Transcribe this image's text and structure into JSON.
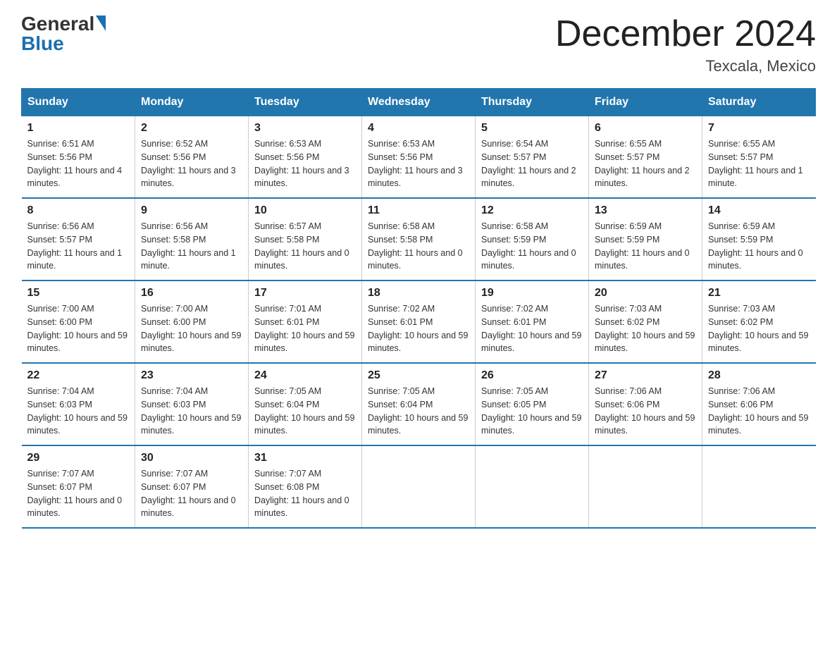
{
  "logo": {
    "general": "General",
    "blue": "Blue"
  },
  "title": "December 2024",
  "location": "Texcala, Mexico",
  "days_of_week": [
    "Sunday",
    "Monday",
    "Tuesday",
    "Wednesday",
    "Thursday",
    "Friday",
    "Saturday"
  ],
  "weeks": [
    [
      {
        "day": "1",
        "sunrise": "6:51 AM",
        "sunset": "5:56 PM",
        "daylight": "11 hours and 4 minutes."
      },
      {
        "day": "2",
        "sunrise": "6:52 AM",
        "sunset": "5:56 PM",
        "daylight": "11 hours and 3 minutes."
      },
      {
        "day": "3",
        "sunrise": "6:53 AM",
        "sunset": "5:56 PM",
        "daylight": "11 hours and 3 minutes."
      },
      {
        "day": "4",
        "sunrise": "6:53 AM",
        "sunset": "5:56 PM",
        "daylight": "11 hours and 3 minutes."
      },
      {
        "day": "5",
        "sunrise": "6:54 AM",
        "sunset": "5:57 PM",
        "daylight": "11 hours and 2 minutes."
      },
      {
        "day": "6",
        "sunrise": "6:55 AM",
        "sunset": "5:57 PM",
        "daylight": "11 hours and 2 minutes."
      },
      {
        "day": "7",
        "sunrise": "6:55 AM",
        "sunset": "5:57 PM",
        "daylight": "11 hours and 1 minute."
      }
    ],
    [
      {
        "day": "8",
        "sunrise": "6:56 AM",
        "sunset": "5:57 PM",
        "daylight": "11 hours and 1 minute."
      },
      {
        "day": "9",
        "sunrise": "6:56 AM",
        "sunset": "5:58 PM",
        "daylight": "11 hours and 1 minute."
      },
      {
        "day": "10",
        "sunrise": "6:57 AM",
        "sunset": "5:58 PM",
        "daylight": "11 hours and 0 minutes."
      },
      {
        "day": "11",
        "sunrise": "6:58 AM",
        "sunset": "5:58 PM",
        "daylight": "11 hours and 0 minutes."
      },
      {
        "day": "12",
        "sunrise": "6:58 AM",
        "sunset": "5:59 PM",
        "daylight": "11 hours and 0 minutes."
      },
      {
        "day": "13",
        "sunrise": "6:59 AM",
        "sunset": "5:59 PM",
        "daylight": "11 hours and 0 minutes."
      },
      {
        "day": "14",
        "sunrise": "6:59 AM",
        "sunset": "5:59 PM",
        "daylight": "11 hours and 0 minutes."
      }
    ],
    [
      {
        "day": "15",
        "sunrise": "7:00 AM",
        "sunset": "6:00 PM",
        "daylight": "10 hours and 59 minutes."
      },
      {
        "day": "16",
        "sunrise": "7:00 AM",
        "sunset": "6:00 PM",
        "daylight": "10 hours and 59 minutes."
      },
      {
        "day": "17",
        "sunrise": "7:01 AM",
        "sunset": "6:01 PM",
        "daylight": "10 hours and 59 minutes."
      },
      {
        "day": "18",
        "sunrise": "7:02 AM",
        "sunset": "6:01 PM",
        "daylight": "10 hours and 59 minutes."
      },
      {
        "day": "19",
        "sunrise": "7:02 AM",
        "sunset": "6:01 PM",
        "daylight": "10 hours and 59 minutes."
      },
      {
        "day": "20",
        "sunrise": "7:03 AM",
        "sunset": "6:02 PM",
        "daylight": "10 hours and 59 minutes."
      },
      {
        "day": "21",
        "sunrise": "7:03 AM",
        "sunset": "6:02 PM",
        "daylight": "10 hours and 59 minutes."
      }
    ],
    [
      {
        "day": "22",
        "sunrise": "7:04 AM",
        "sunset": "6:03 PM",
        "daylight": "10 hours and 59 minutes."
      },
      {
        "day": "23",
        "sunrise": "7:04 AM",
        "sunset": "6:03 PM",
        "daylight": "10 hours and 59 minutes."
      },
      {
        "day": "24",
        "sunrise": "7:05 AM",
        "sunset": "6:04 PM",
        "daylight": "10 hours and 59 minutes."
      },
      {
        "day": "25",
        "sunrise": "7:05 AM",
        "sunset": "6:04 PM",
        "daylight": "10 hours and 59 minutes."
      },
      {
        "day": "26",
        "sunrise": "7:05 AM",
        "sunset": "6:05 PM",
        "daylight": "10 hours and 59 minutes."
      },
      {
        "day": "27",
        "sunrise": "7:06 AM",
        "sunset": "6:06 PM",
        "daylight": "10 hours and 59 minutes."
      },
      {
        "day": "28",
        "sunrise": "7:06 AM",
        "sunset": "6:06 PM",
        "daylight": "10 hours and 59 minutes."
      }
    ],
    [
      {
        "day": "29",
        "sunrise": "7:07 AM",
        "sunset": "6:07 PM",
        "daylight": "11 hours and 0 minutes."
      },
      {
        "day": "30",
        "sunrise": "7:07 AM",
        "sunset": "6:07 PM",
        "daylight": "11 hours and 0 minutes."
      },
      {
        "day": "31",
        "sunrise": "7:07 AM",
        "sunset": "6:08 PM",
        "daylight": "11 hours and 0 minutes."
      },
      null,
      null,
      null,
      null
    ]
  ]
}
